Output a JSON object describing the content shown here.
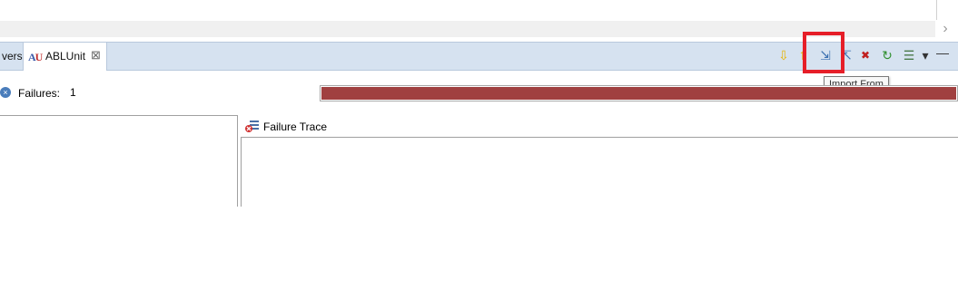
{
  "tabs": {
    "partial_label": "vers",
    "active": {
      "icon_text_a": "A",
      "icon_text_u": "U",
      "label": "ABLUnit",
      "close_glyph": "⊠"
    }
  },
  "toolbar": {
    "icons": [
      {
        "name": "next-failure-icon",
        "glyph": "⇩",
        "color": "#e8b400"
      },
      {
        "name": "previous-failure-icon",
        "glyph": "⇧",
        "color": "#e8b400"
      },
      {
        "name": "import-from-icon",
        "glyph": "⇲",
        "color": "#3a6fb0"
      },
      {
        "name": "export-to-icon",
        "glyph": "⇱",
        "color": "#3a6fb0"
      },
      {
        "name": "show-failures-only-icon",
        "glyph": "✖",
        "color": "#c02020"
      },
      {
        "name": "rerun-icon",
        "glyph": "↻",
        "color": "#2f8f2f"
      },
      {
        "name": "layout-menu-icon",
        "glyph": "☰",
        "color": "#4a7a4a"
      },
      {
        "name": "view-menu-icon",
        "glyph": "▾",
        "color": "#333333"
      },
      {
        "name": "minimize-icon",
        "glyph": "—",
        "color": "#333333"
      }
    ],
    "highlight_color": "#e61e28"
  },
  "tooltip": {
    "text": "Import From"
  },
  "status": {
    "failures_label": "Failures:",
    "failures_count": "1",
    "progress": 1.0,
    "progress_color": "#a04040"
  },
  "trace": {
    "label": "Failure Trace"
  },
  "scroll": {
    "right_glyph": "›"
  }
}
